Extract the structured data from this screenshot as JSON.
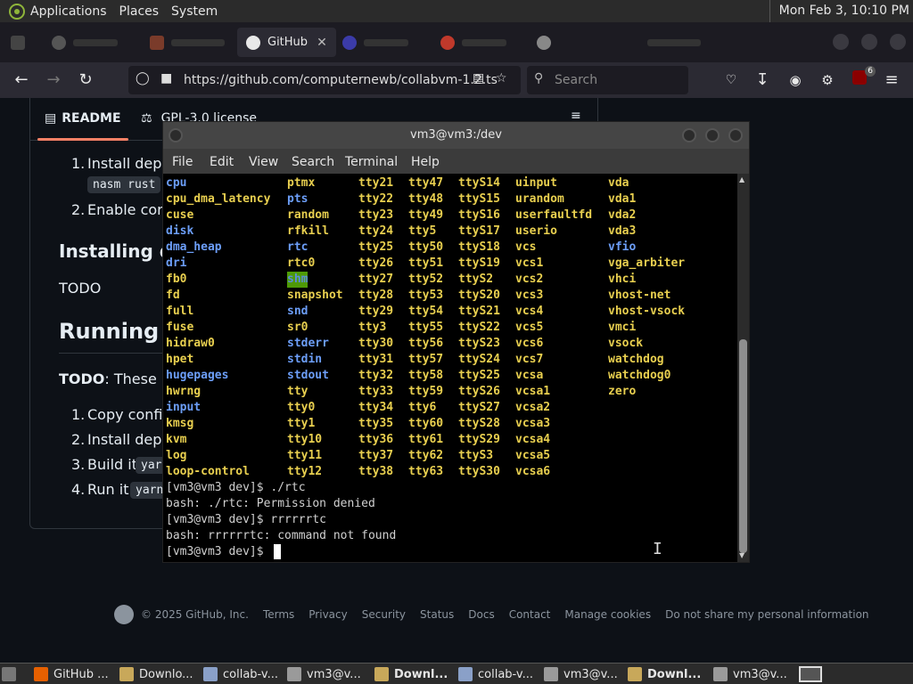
{
  "top_panel": {
    "menus": [
      "Applications",
      "Places",
      "System"
    ],
    "clock": "Mon Feb  3, 10:10 PM"
  },
  "browser": {
    "active_tab": "GitHub",
    "close_glyph": "✕",
    "url": "https://github.com/computernewb/collabvm-1.2.ts",
    "search_placeholder": "Search",
    "extension_badge": "6"
  },
  "github": {
    "readme_tab": "README",
    "license_tab": "GPL-3.0 license",
    "list1": {
      "item1": "Install deper",
      "item1_code_a": "nasm rust",
      "item2": "Enable core"
    },
    "installing_heading": "Installing de",
    "todo": "TODO",
    "running_heading": "Running",
    "running_note_bold": "TODO",
    "running_note_rest": ": These in",
    "list2": {
      "item1": "Copy config",
      "item2": "Install deper",
      "item3": "Build it:",
      "item3_code": "yar",
      "item4": "Run it:",
      "item4_code": "yarn"
    },
    "numbers": [
      "1.",
      "2.",
      "1.",
      "2.",
      "3.",
      "4."
    ],
    "footer": [
      "© 2025 GitHub, Inc.",
      "Terms",
      "Privacy",
      "Security",
      "Status",
      "Docs",
      "Contact",
      "Manage cookies",
      "Do not share my personal information"
    ]
  },
  "terminal": {
    "title": "vm3@vm3:/dev",
    "menu": [
      "File",
      "Edit",
      "View",
      "Search",
      "Terminal",
      "Help"
    ],
    "columns": [
      [
        [
          "cpu",
          "dir"
        ],
        [
          "cpu_dma_latency",
          "dev"
        ],
        [
          "cuse",
          "dev"
        ],
        [
          "disk",
          "dir"
        ],
        [
          "dma_heap",
          "dir"
        ],
        [
          "dri",
          "dir"
        ],
        [
          "fb0",
          "dev"
        ],
        [
          "fd",
          "dev"
        ],
        [
          "full",
          "dev"
        ],
        [
          "fuse",
          "dev"
        ],
        [
          "hidraw0",
          "dev"
        ],
        [
          "hpet",
          "dev"
        ],
        [
          "hugepages",
          "dir"
        ],
        [
          "hwrng",
          "dev"
        ],
        [
          "input",
          "dir"
        ],
        [
          "kmsg",
          "dev"
        ],
        [
          "kvm",
          "dev"
        ],
        [
          "log",
          "dev"
        ],
        [
          "loop-control",
          "dev"
        ]
      ],
      [
        [
          "ptmx",
          "dev"
        ],
        [
          "pts",
          "dir"
        ],
        [
          "random",
          "dev"
        ],
        [
          "rfkill",
          "dev"
        ],
        [
          "rtc",
          "dir"
        ],
        [
          "rtc0",
          "dev"
        ],
        [
          "shm",
          "hl"
        ],
        [
          "snapshot",
          "dev"
        ],
        [
          "snd",
          "dir"
        ],
        [
          "sr0",
          "dev"
        ],
        [
          "stderr",
          "dir"
        ],
        [
          "stdin",
          "dir"
        ],
        [
          "stdout",
          "dir"
        ],
        [
          "tty",
          "dev"
        ],
        [
          "tty0",
          "dev"
        ],
        [
          "tty1",
          "dev"
        ],
        [
          "tty10",
          "dev"
        ],
        [
          "tty11",
          "dev"
        ],
        [
          "tty12",
          "dev"
        ]
      ],
      [
        [
          "tty21",
          "dev"
        ],
        [
          "tty22",
          "dev"
        ],
        [
          "tty23",
          "dev"
        ],
        [
          "tty24",
          "dev"
        ],
        [
          "tty25",
          "dev"
        ],
        [
          "tty26",
          "dev"
        ],
        [
          "tty27",
          "dev"
        ],
        [
          "tty28",
          "dev"
        ],
        [
          "tty29",
          "dev"
        ],
        [
          "tty3",
          "dev"
        ],
        [
          "tty30",
          "dev"
        ],
        [
          "tty31",
          "dev"
        ],
        [
          "tty32",
          "dev"
        ],
        [
          "tty33",
          "dev"
        ],
        [
          "tty34",
          "dev"
        ],
        [
          "tty35",
          "dev"
        ],
        [
          "tty36",
          "dev"
        ],
        [
          "tty37",
          "dev"
        ],
        [
          "tty38",
          "dev"
        ]
      ],
      [
        [
          "tty47",
          "dev"
        ],
        [
          "tty48",
          "dev"
        ],
        [
          "tty49",
          "dev"
        ],
        [
          "tty5",
          "dev"
        ],
        [
          "tty50",
          "dev"
        ],
        [
          "tty51",
          "dev"
        ],
        [
          "tty52",
          "dev"
        ],
        [
          "tty53",
          "dev"
        ],
        [
          "tty54",
          "dev"
        ],
        [
          "tty55",
          "dev"
        ],
        [
          "tty56",
          "dev"
        ],
        [
          "tty57",
          "dev"
        ],
        [
          "tty58",
          "dev"
        ],
        [
          "tty59",
          "dev"
        ],
        [
          "tty6",
          "dev"
        ],
        [
          "tty60",
          "dev"
        ],
        [
          "tty61",
          "dev"
        ],
        [
          "tty62",
          "dev"
        ],
        [
          "tty63",
          "dev"
        ]
      ],
      [
        [
          "ttyS14",
          "dev"
        ],
        [
          "ttyS15",
          "dev"
        ],
        [
          "ttyS16",
          "dev"
        ],
        [
          "ttyS17",
          "dev"
        ],
        [
          "ttyS18",
          "dev"
        ],
        [
          "ttyS19",
          "dev"
        ],
        [
          "ttyS2",
          "dev"
        ],
        [
          "ttyS20",
          "dev"
        ],
        [
          "ttyS21",
          "dev"
        ],
        [
          "ttyS22",
          "dev"
        ],
        [
          "ttyS23",
          "dev"
        ],
        [
          "ttyS24",
          "dev"
        ],
        [
          "ttyS25",
          "dev"
        ],
        [
          "ttyS26",
          "dev"
        ],
        [
          "ttyS27",
          "dev"
        ],
        [
          "ttyS28",
          "dev"
        ],
        [
          "ttyS29",
          "dev"
        ],
        [
          "ttyS3",
          "dev"
        ],
        [
          "ttyS30",
          "dev"
        ]
      ],
      [
        [
          "uinput",
          "dev"
        ],
        [
          "urandom",
          "dev"
        ],
        [
          "userfaultfd",
          "dev"
        ],
        [
          "userio",
          "dev"
        ],
        [
          "vcs",
          "dev"
        ],
        [
          "vcs1",
          "dev"
        ],
        [
          "vcs2",
          "dev"
        ],
        [
          "vcs3",
          "dev"
        ],
        [
          "vcs4",
          "dev"
        ],
        [
          "vcs5",
          "dev"
        ],
        [
          "vcs6",
          "dev"
        ],
        [
          "vcs7",
          "dev"
        ],
        [
          "vcsa",
          "dev"
        ],
        [
          "vcsa1",
          "dev"
        ],
        [
          "vcsa2",
          "dev"
        ],
        [
          "vcsa3",
          "dev"
        ],
        [
          "vcsa4",
          "dev"
        ],
        [
          "vcsa5",
          "dev"
        ],
        [
          "vcsa6",
          "dev"
        ]
      ],
      [
        [
          "vda",
          "dev"
        ],
        [
          "vda1",
          "dev"
        ],
        [
          "vda2",
          "dev"
        ],
        [
          "vda3",
          "dev"
        ],
        [
          "vfio",
          "dir"
        ],
        [
          "vga_arbiter",
          "dev"
        ],
        [
          "vhci",
          "dev"
        ],
        [
          "vhost-net",
          "dev"
        ],
        [
          "vhost-vsock",
          "dev"
        ],
        [
          "vmci",
          "dev"
        ],
        [
          "vsock",
          "dev"
        ],
        [
          "watchdog",
          "dev"
        ],
        [
          "watchdog0",
          "dev"
        ],
        [
          "zero",
          "dev"
        ]
      ]
    ],
    "history": [
      "[vm3@vm3 dev]$ ./rtc",
      "bash: ./rtc: Permission denied",
      "[vm3@vm3 dev]$ rrrrrrtc",
      "bash: rrrrrrtc: command not found",
      "[vm3@vm3 dev]$ "
    ]
  },
  "taskbar": {
    "items": [
      {
        "label": "GitHub ...",
        "bold": false,
        "color": "#e66000"
      },
      {
        "label": "Downlo...",
        "bold": false,
        "color": "#c8a85a"
      },
      {
        "label": "collab-v...",
        "bold": false,
        "color": "#8aa0c8"
      },
      {
        "label": "vm3@v...",
        "bold": false,
        "color": "#9a9a9a"
      },
      {
        "label": "Downl...",
        "bold": true,
        "color": "#c8a85a"
      },
      {
        "label": "collab-v...",
        "bold": false,
        "color": "#8aa0c8"
      },
      {
        "label": "vm3@v...",
        "bold": false,
        "color": "#9a9a9a"
      },
      {
        "label": "Downl...",
        "bold": true,
        "color": "#c8a85a"
      },
      {
        "label": "vm3@v...",
        "bold": false,
        "color": "#9a9a9a"
      }
    ]
  },
  "colors": {
    "gh_underline": "#f78166",
    "term_device": "#e8cf4f",
    "term_directory": "#6c9ef8",
    "term_highlight_bg": "#4e9a06"
  }
}
